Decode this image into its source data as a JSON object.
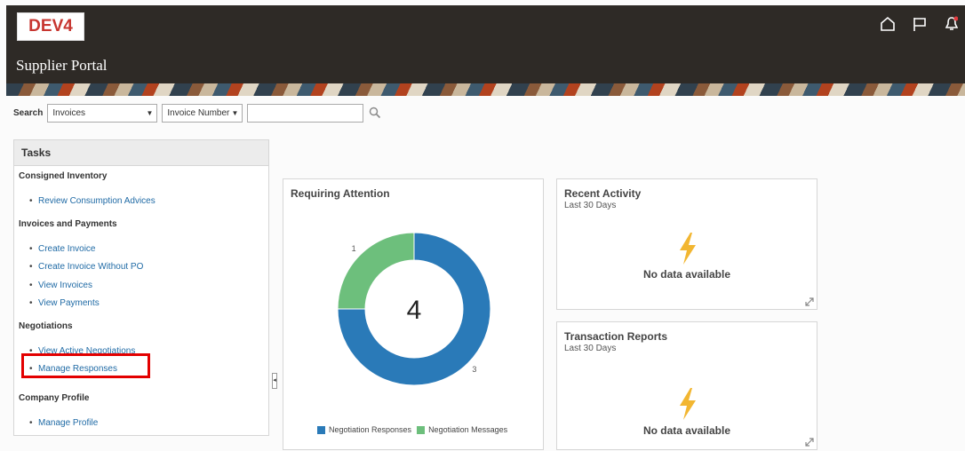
{
  "header": {
    "env_badge": "DEV4",
    "portal_title": "Supplier Portal",
    "icons": [
      "home-icon",
      "flag-icon",
      "bell-icon"
    ]
  },
  "search": {
    "label": "Search",
    "category": "Invoices",
    "field": "Invoice Number",
    "value": ""
  },
  "tasks": {
    "title": "Tasks",
    "sections": [
      {
        "title": "Consigned Inventory",
        "links": [
          "Review Consumption Advices"
        ]
      },
      {
        "title": "Invoices and Payments",
        "links": [
          "Create Invoice",
          "Create Invoice Without PO",
          "View Invoices",
          "View Payments"
        ]
      },
      {
        "title": "Negotiations",
        "links": [
          "View Active Negotiations",
          "Manage Responses"
        ]
      },
      {
        "title": "Company Profile",
        "links": [
          "Manage Profile"
        ]
      }
    ]
  },
  "requiring_attention": {
    "title": "Requiring Attention",
    "total": "4",
    "slice_labels": [
      "3",
      "1"
    ]
  },
  "chart_data": {
    "type": "pie",
    "categories": [
      "Negotiation Responses",
      "Negotiation Messages"
    ],
    "values": [
      3,
      1
    ],
    "colors": [
      "#2a7ab8",
      "#6dbf7c"
    ]
  },
  "recent_activity": {
    "title": "Recent Activity",
    "subtitle": "Last 30 Days",
    "message": "No data available"
  },
  "transaction_reports": {
    "title": "Transaction Reports",
    "subtitle": "Last 30 Days",
    "message": "No data available"
  },
  "colors": {
    "header_bg": "#2e2a26",
    "link": "#1f6aa5",
    "highlight": "#e30000",
    "lightning": "#f2b631"
  }
}
